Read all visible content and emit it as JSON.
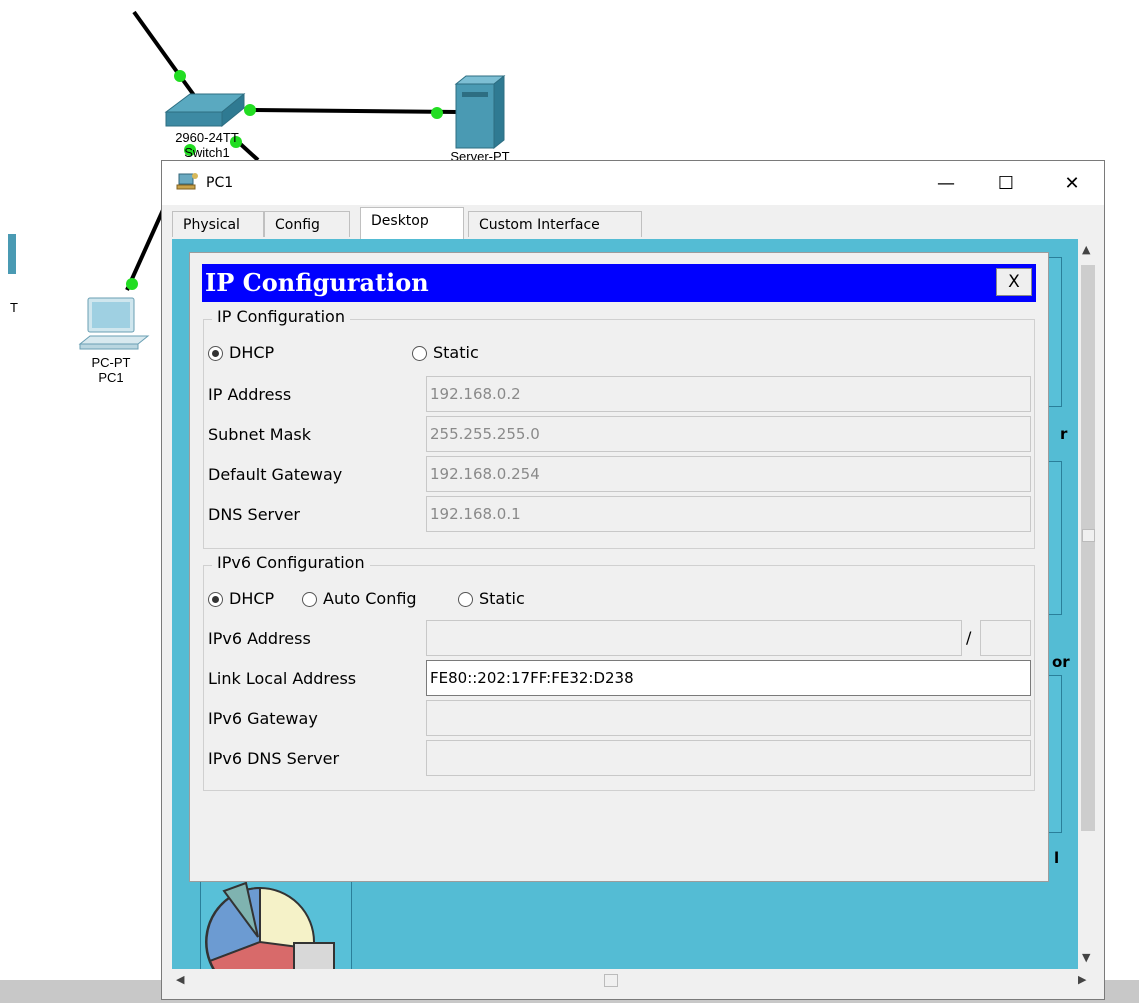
{
  "topology": {
    "switch": {
      "model_label": "2960-24TT",
      "name_label": "Switch1"
    },
    "server": {
      "model_label": "Server-PT"
    },
    "pc": {
      "model_label": "PC-PT",
      "name_label": "PC1"
    },
    "left_edge_label": "T",
    "link_dot_color": "#22dd22"
  },
  "window": {
    "title": "PC1",
    "controls": {
      "minimize": "—",
      "maximize": "☐",
      "close": "✕"
    },
    "tabs": [
      {
        "label": "Physical"
      },
      {
        "label": "Config"
      },
      {
        "label": "Desktop",
        "active": true
      },
      {
        "label": "Custom Interface"
      }
    ],
    "desktop_background": "#54bcd4",
    "peek_labels": {
      "r": "r",
      "or": "or",
      "l": "l"
    }
  },
  "dialog": {
    "title": "IP Configuration",
    "close_label": "X",
    "title_bar_color": "#0000ff",
    "ipv4": {
      "legend": "IP Configuration",
      "mode_options": [
        {
          "label": "DHCP",
          "selected": true
        },
        {
          "label": "Static",
          "selected": false
        }
      ],
      "fields": [
        {
          "label": "IP Address",
          "value": "192.168.0.2"
        },
        {
          "label": "Subnet Mask",
          "value": "255.255.255.0"
        },
        {
          "label": "Default Gateway",
          "value": "192.168.0.254"
        },
        {
          "label": "DNS Server",
          "value": "192.168.0.1"
        }
      ]
    },
    "ipv6": {
      "legend": "IPv6 Configuration",
      "mode_options": [
        {
          "label": "DHCP",
          "selected": true
        },
        {
          "label": "Auto Config",
          "selected": false
        },
        {
          "label": "Static",
          "selected": false
        }
      ],
      "address_label": "IPv6 Address",
      "address_value": "",
      "prefix_separator": "/",
      "prefix_value": "",
      "link_local_label": "Link Local Address",
      "link_local_value": "FE80::202:17FF:FE32:D238",
      "gateway_label": "IPv6 Gateway",
      "gateway_value": "",
      "dns_label": "IPv6 DNS Server",
      "dns_value": ""
    }
  }
}
